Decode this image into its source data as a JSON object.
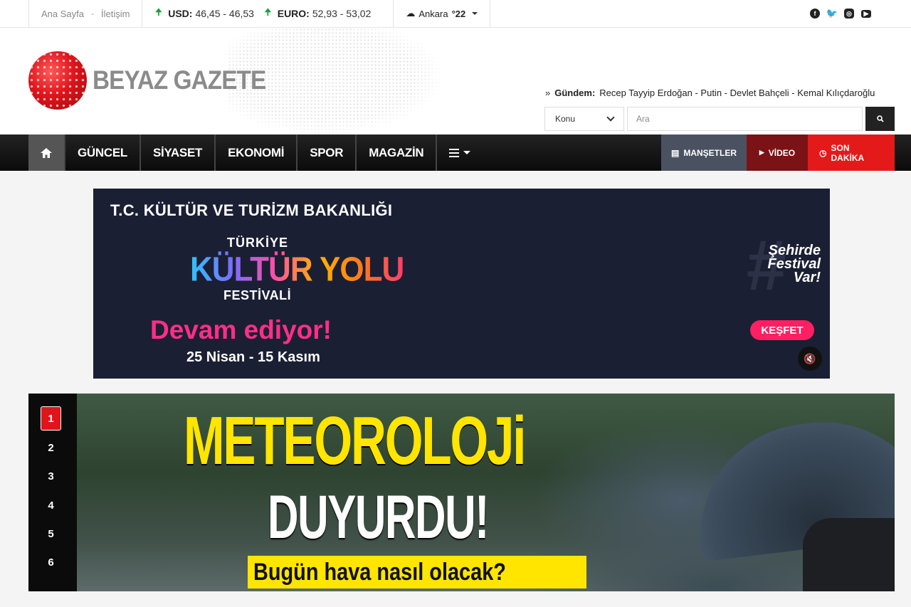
{
  "topbar": {
    "links": [
      "Ana Sayfa",
      "İletişim"
    ],
    "separator": "-",
    "currencies": [
      {
        "name": "USD:",
        "value": "46,45 - 46,53"
      },
      {
        "name": "EURO:",
        "value": "52,93 - 53,02"
      }
    ],
    "weather": {
      "city": "Ankara",
      "temp": "°22"
    },
    "social_icons": [
      "facebook-icon",
      "twitter-icon",
      "instagram-icon",
      "youtube-icon"
    ]
  },
  "header": {
    "brand": "BEYAZ GAZETE",
    "gundem_label": "Gündem:",
    "gundem_items": "Recep Tayyip Erdoğan - Putin - Devlet Bahçeli - Kemal Kılıçdaroğlu",
    "konu_label": "Konu",
    "search_placeholder": "Ara"
  },
  "nav": {
    "items": [
      "GÜNCEL",
      "SİYASET",
      "EKONOMİ",
      "SPOR",
      "MAGAZİN"
    ],
    "right": [
      "MANŞETLER",
      "VİDEO",
      "SON DAKİKA"
    ],
    "colors": {
      "mansetler": "#4a5262",
      "video": "#7b1216",
      "son_dakika": "#e41a1a"
    }
  },
  "ad": {
    "ministry": "T.C. KÜLTÜR VE TURİZM BAKANLIĞI",
    "line1": "TÜRKİYE",
    "line2": "KÜLTÜR YOLU",
    "line3": "FESTİVALİ",
    "status": "Devam ediyor!",
    "dates": "25 Nisan - 15 Kasım",
    "slogan": "Şehirde Festival Var!",
    "cta": "KEŞFET"
  },
  "slider": {
    "numbers": [
      "1",
      "2",
      "3",
      "4",
      "5",
      "6"
    ],
    "active_index": 0,
    "headline1": "METEOROLOJi",
    "headline2": "DUYURDU!",
    "headline3": "Bugün hava nasıl olacak?"
  }
}
